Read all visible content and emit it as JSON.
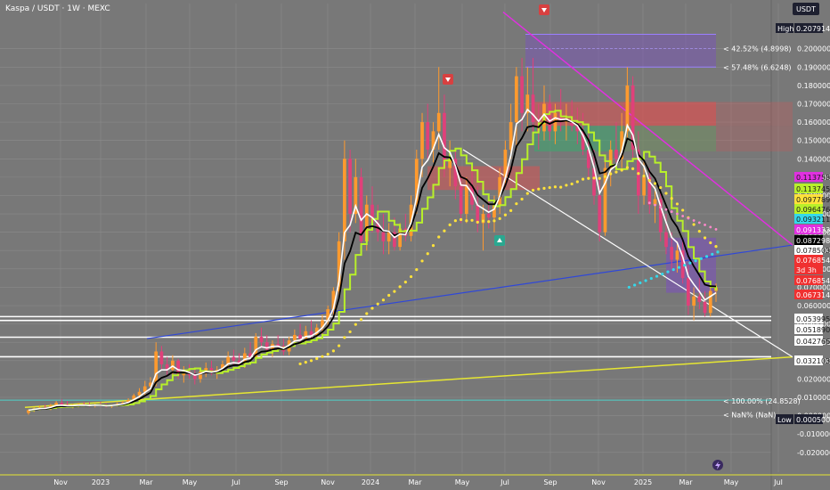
{
  "header": {
    "title": "Kaspa / USDT · 1W · MEXC",
    "currency": "USDT"
  },
  "colors": {
    "background": "#787878",
    "candle_up": "#ff9a2e",
    "candle_down": "#e0407a",
    "ema_fast": "#ffffff",
    "ema_slow": "#000000",
    "step_line": "#b8f02a",
    "dots": "#ffe23a",
    "dots_blue": "#35d8ea",
    "trend_blue": "#3048d8",
    "trend_yellow": "#e6e632",
    "trend_magenta": "#e030e0",
    "trend_white": "#ffffff",
    "supply_zone": "#e05050",
    "demand_zone": "#3aa86e",
    "purple_zone": "#7b4fc0"
  },
  "chart_data": {
    "type": "candlestick",
    "title": "Kaspa / USDT · 1W · MEXC",
    "x_ticks": [
      "Nov",
      "2023",
      "Mar",
      "May",
      "Jul",
      "Sep",
      "Nov",
      "2024",
      "Mar",
      "May",
      "Jul",
      "Sep",
      "Nov",
      "2025",
      "Mar",
      "May",
      "Jul"
    ],
    "y_ticks": [
      0.2,
      0.19,
      0.18,
      0.17,
      0.16,
      0.15,
      0.14,
      0.13,
      0.12,
      0.11,
      0.1,
      0.09,
      0.08,
      0.07,
      0.06,
      0.05,
      0.04,
      0.03,
      0.02,
      0.01,
      0.0,
      -0.01,
      -0.02
    ],
    "ylim": [
      -0.024,
      0.212
    ],
    "price_tags": [
      {
        "label": "High",
        "value": "0.207914",
        "color": "#ffffff",
        "bg": "#1e2030"
      },
      {
        "label": "",
        "value": "0.113758",
        "color": "#1a1a1a",
        "bg": "#e030e0"
      },
      {
        "label": "",
        "value": "0.113745",
        "color": "#1a1a1a",
        "bg": "#b8f02a"
      },
      {
        "label": "",
        "value": "0.097789",
        "color": "#1a1a1a",
        "bg": "#ffe23a"
      },
      {
        "label": "",
        "value": "0.096476",
        "color": "#1a1a1a",
        "bg": "#b8f02a"
      },
      {
        "label": "",
        "value": "0.093211",
        "color": "#1a1a1a",
        "bg": "#35d8ea"
      },
      {
        "label": "",
        "value": "0.091333",
        "color": "#ffffff",
        "bg": "#e030e0"
      },
      {
        "label": "",
        "value": "0.087298",
        "color": "#ffffff",
        "bg": "#000000"
      },
      {
        "label": "",
        "value": "0.078503",
        "color": "#1a1a1a",
        "bg": "#ffffff"
      },
      {
        "label": "",
        "value": "0.076854",
        "color": "#ffffff",
        "bg": "#f03030"
      },
      {
        "label": "",
        "value": "3d 3h",
        "color": "#ffffff",
        "bg": "#f03030"
      },
      {
        "label": "",
        "value": "0.076854",
        "color": "#ffffff",
        "bg": "#f03030"
      },
      {
        "label": "",
        "value": "0.067314",
        "color": "#ffffff",
        "bg": "#f03030"
      },
      {
        "label": "",
        "value": "0.053995",
        "color": "#1a1a1a",
        "bg": "#ffffff"
      },
      {
        "label": "",
        "value": "0.051890",
        "color": "#1a1a1a",
        "bg": "#ffffff"
      },
      {
        "label": "",
        "value": "0.042766",
        "color": "#1a1a1a",
        "bg": "#ffffff"
      },
      {
        "label": "",
        "value": "0.032103",
        "color": "#1a1a1a",
        "bg": "#ffffff"
      },
      {
        "label": "Low",
        "value": "0.000500",
        "color": "#ffffff",
        "bg": "#1e2030"
      }
    ],
    "fib_labels": [
      {
        "text": "42.52% (4.8998)",
        "value": 0.2
      },
      {
        "text": "57.48% (6.6248)",
        "value": 0.19
      },
      {
        "text": "100.00% (24.8528)",
        "value": 0.008
      },
      {
        "text": "NaN% (NaN)",
        "value": 0.0005
      }
    ],
    "horizontal_lines": [
      0.053995,
      0.05189,
      0.042766,
      0.032103
    ],
    "candles": [
      {
        "o": 0.0015,
        "h": 0.0035,
        "l": 0.0005,
        "c": 0.003
      },
      {
        "o": 0.003,
        "h": 0.0045,
        "l": 0.002,
        "c": 0.004
      },
      {
        "o": 0.004,
        "h": 0.0055,
        "l": 0.003,
        "c": 0.0045
      },
      {
        "o": 0.0045,
        "h": 0.006,
        "l": 0.0035,
        "c": 0.004
      },
      {
        "o": 0.004,
        "h": 0.0065,
        "l": 0.003,
        "c": 0.0055
      },
      {
        "o": 0.0055,
        "h": 0.008,
        "l": 0.0045,
        "c": 0.007
      },
      {
        "o": 0.007,
        "h": 0.009,
        "l": 0.005,
        "c": 0.006
      },
      {
        "o": 0.006,
        "h": 0.008,
        "l": 0.0045,
        "c": 0.005
      },
      {
        "o": 0.005,
        "h": 0.0065,
        "l": 0.004,
        "c": 0.0055
      },
      {
        "o": 0.0055,
        "h": 0.007,
        "l": 0.0045,
        "c": 0.006
      },
      {
        "o": 0.006,
        "h": 0.0075,
        "l": 0.005,
        "c": 0.0058
      },
      {
        "o": 0.0058,
        "h": 0.0072,
        "l": 0.0048,
        "c": 0.0052
      },
      {
        "o": 0.0052,
        "h": 0.0068,
        "l": 0.0045,
        "c": 0.006
      },
      {
        "o": 0.006,
        "h": 0.0075,
        "l": 0.005,
        "c": 0.0055
      },
      {
        "o": 0.0055,
        "h": 0.0068,
        "l": 0.0045,
        "c": 0.005
      },
      {
        "o": 0.005,
        "h": 0.0062,
        "l": 0.0042,
        "c": 0.0058
      },
      {
        "o": 0.0058,
        "h": 0.0072,
        "l": 0.005,
        "c": 0.0065
      },
      {
        "o": 0.0065,
        "h": 0.008,
        "l": 0.0055,
        "c": 0.007
      },
      {
        "o": 0.007,
        "h": 0.0095,
        "l": 0.006,
        "c": 0.0085
      },
      {
        "o": 0.0085,
        "h": 0.012,
        "l": 0.0075,
        "c": 0.011
      },
      {
        "o": 0.011,
        "h": 0.015,
        "l": 0.0095,
        "c": 0.013
      },
      {
        "o": 0.013,
        "h": 0.019,
        "l": 0.011,
        "c": 0.016
      },
      {
        "o": 0.016,
        "h": 0.021,
        "l": 0.014,
        "c": 0.018
      },
      {
        "o": 0.018,
        "h": 0.04,
        "l": 0.016,
        "c": 0.035
      },
      {
        "o": 0.035,
        "h": 0.038,
        "l": 0.025,
        "c": 0.028
      },
      {
        "o": 0.028,
        "h": 0.032,
        "l": 0.022,
        "c": 0.025
      },
      {
        "o": 0.025,
        "h": 0.033,
        "l": 0.022,
        "c": 0.03
      },
      {
        "o": 0.03,
        "h": 0.031,
        "l": 0.02,
        "c": 0.022
      },
      {
        "o": 0.022,
        "h": 0.027,
        "l": 0.018,
        "c": 0.024
      },
      {
        "o": 0.024,
        "h": 0.028,
        "l": 0.02,
        "c": 0.022
      },
      {
        "o": 0.022,
        "h": 0.025,
        "l": 0.017,
        "c": 0.02
      },
      {
        "o": 0.02,
        "h": 0.026,
        "l": 0.018,
        "c": 0.024
      },
      {
        "o": 0.024,
        "h": 0.029,
        "l": 0.021,
        "c": 0.026
      },
      {
        "o": 0.026,
        "h": 0.03,
        "l": 0.022,
        "c": 0.023
      },
      {
        "o": 0.023,
        "h": 0.027,
        "l": 0.02,
        "c": 0.025
      },
      {
        "o": 0.025,
        "h": 0.03,
        "l": 0.023,
        "c": 0.028
      },
      {
        "o": 0.028,
        "h": 0.035,
        "l": 0.026,
        "c": 0.032
      },
      {
        "o": 0.032,
        "h": 0.036,
        "l": 0.027,
        "c": 0.03
      },
      {
        "o": 0.03,
        "h": 0.034,
        "l": 0.026,
        "c": 0.028
      },
      {
        "o": 0.028,
        "h": 0.037,
        "l": 0.026,
        "c": 0.034
      },
      {
        "o": 0.034,
        "h": 0.04,
        "l": 0.03,
        "c": 0.032
      },
      {
        "o": 0.032,
        "h": 0.045,
        "l": 0.03,
        "c": 0.043
      },
      {
        "o": 0.043,
        "h": 0.048,
        "l": 0.037,
        "c": 0.04
      },
      {
        "o": 0.04,
        "h": 0.044,
        "l": 0.034,
        "c": 0.036
      },
      {
        "o": 0.036,
        "h": 0.041,
        "l": 0.032,
        "c": 0.039
      },
      {
        "o": 0.039,
        "h": 0.044,
        "l": 0.035,
        "c": 0.038
      },
      {
        "o": 0.038,
        "h": 0.042,
        "l": 0.033,
        "c": 0.035
      },
      {
        "o": 0.035,
        "h": 0.043,
        "l": 0.033,
        "c": 0.041
      },
      {
        "o": 0.041,
        "h": 0.047,
        "l": 0.038,
        "c": 0.044
      },
      {
        "o": 0.044,
        "h": 0.05,
        "l": 0.04,
        "c": 0.042
      },
      {
        "o": 0.042,
        "h": 0.049,
        "l": 0.039,
        "c": 0.046
      },
      {
        "o": 0.046,
        "h": 0.052,
        "l": 0.042,
        "c": 0.044
      },
      {
        "o": 0.044,
        "h": 0.05,
        "l": 0.041,
        "c": 0.048
      },
      {
        "o": 0.048,
        "h": 0.055,
        "l": 0.044,
        "c": 0.052
      },
      {
        "o": 0.052,
        "h": 0.06,
        "l": 0.048,
        "c": 0.058
      },
      {
        "o": 0.058,
        "h": 0.07,
        "l": 0.054,
        "c": 0.068
      },
      {
        "o": 0.068,
        "h": 0.1,
        "l": 0.065,
        "c": 0.095
      },
      {
        "o": 0.095,
        "h": 0.15,
        "l": 0.085,
        "c": 0.14
      },
      {
        "o": 0.14,
        "h": 0.145,
        "l": 0.1,
        "c": 0.11
      },
      {
        "o": 0.11,
        "h": 0.14,
        "l": 0.105,
        "c": 0.13
      },
      {
        "o": 0.13,
        "h": 0.135,
        "l": 0.09,
        "c": 0.095
      },
      {
        "o": 0.095,
        "h": 0.12,
        "l": 0.09,
        "c": 0.115
      },
      {
        "o": 0.115,
        "h": 0.125,
        "l": 0.1,
        "c": 0.105
      },
      {
        "o": 0.105,
        "h": 0.115,
        "l": 0.095,
        "c": 0.1
      },
      {
        "o": 0.1,
        "h": 0.11,
        "l": 0.088,
        "c": 0.095
      },
      {
        "o": 0.095,
        "h": 0.105,
        "l": 0.088,
        "c": 0.1
      },
      {
        "o": 0.1,
        "h": 0.108,
        "l": 0.09,
        "c": 0.092
      },
      {
        "o": 0.092,
        "h": 0.105,
        "l": 0.09,
        "c": 0.102
      },
      {
        "o": 0.102,
        "h": 0.11,
        "l": 0.095,
        "c": 0.098
      },
      {
        "o": 0.098,
        "h": 0.12,
        "l": 0.095,
        "c": 0.115
      },
      {
        "o": 0.115,
        "h": 0.145,
        "l": 0.11,
        "c": 0.14
      },
      {
        "o": 0.14,
        "h": 0.165,
        "l": 0.13,
        "c": 0.16
      },
      {
        "o": 0.16,
        "h": 0.17,
        "l": 0.14,
        "c": 0.145
      },
      {
        "o": 0.145,
        "h": 0.16,
        "l": 0.138,
        "c": 0.155
      },
      {
        "o": 0.155,
        "h": 0.19,
        "l": 0.145,
        "c": 0.165
      },
      {
        "o": 0.165,
        "h": 0.175,
        "l": 0.13,
        "c": 0.135
      },
      {
        "o": 0.135,
        "h": 0.15,
        "l": 0.125,
        "c": 0.14
      },
      {
        "o": 0.14,
        "h": 0.145,
        "l": 0.118,
        "c": 0.125
      },
      {
        "o": 0.125,
        "h": 0.13,
        "l": 0.105,
        "c": 0.11
      },
      {
        "o": 0.11,
        "h": 0.13,
        "l": 0.105,
        "c": 0.125
      },
      {
        "o": 0.125,
        "h": 0.135,
        "l": 0.112,
        "c": 0.115
      },
      {
        "o": 0.115,
        "h": 0.125,
        "l": 0.1,
        "c": 0.105
      },
      {
        "o": 0.105,
        "h": 0.115,
        "l": 0.09,
        "c": 0.11
      },
      {
        "o": 0.11,
        "h": 0.12,
        "l": 0.102,
        "c": 0.108
      },
      {
        "o": 0.108,
        "h": 0.12,
        "l": 0.1,
        "c": 0.115
      },
      {
        "o": 0.115,
        "h": 0.135,
        "l": 0.11,
        "c": 0.13
      },
      {
        "o": 0.13,
        "h": 0.15,
        "l": 0.125,
        "c": 0.145
      },
      {
        "o": 0.145,
        "h": 0.17,
        "l": 0.14,
        "c": 0.16
      },
      {
        "o": 0.16,
        "h": 0.19,
        "l": 0.145,
        "c": 0.185
      },
      {
        "o": 0.185,
        "h": 0.195,
        "l": 0.155,
        "c": 0.165
      },
      {
        "o": 0.165,
        "h": 0.19,
        "l": 0.155,
        "c": 0.175
      },
      {
        "o": 0.175,
        "h": 0.195,
        "l": 0.15,
        "c": 0.16
      },
      {
        "o": 0.16,
        "h": 0.17,
        "l": 0.145,
        "c": 0.155
      },
      {
        "o": 0.155,
        "h": 0.18,
        "l": 0.15,
        "c": 0.17
      },
      {
        "o": 0.17,
        "h": 0.175,
        "l": 0.15,
        "c": 0.155
      },
      {
        "o": 0.155,
        "h": 0.17,
        "l": 0.148,
        "c": 0.165
      },
      {
        "o": 0.165,
        "h": 0.178,
        "l": 0.155,
        "c": 0.16
      },
      {
        "o": 0.16,
        "h": 0.17,
        "l": 0.15,
        "c": 0.162
      },
      {
        "o": 0.162,
        "h": 0.172,
        "l": 0.155,
        "c": 0.158
      },
      {
        "o": 0.158,
        "h": 0.168,
        "l": 0.148,
        "c": 0.155
      },
      {
        "o": 0.155,
        "h": 0.165,
        "l": 0.142,
        "c": 0.145
      },
      {
        "o": 0.145,
        "h": 0.155,
        "l": 0.13,
        "c": 0.135
      },
      {
        "o": 0.135,
        "h": 0.145,
        "l": 0.115,
        "c": 0.12
      },
      {
        "o": 0.12,
        "h": 0.13,
        "l": 0.095,
        "c": 0.1
      },
      {
        "o": 0.1,
        "h": 0.14,
        "l": 0.098,
        "c": 0.135
      },
      {
        "o": 0.135,
        "h": 0.15,
        "l": 0.125,
        "c": 0.145
      },
      {
        "o": 0.145,
        "h": 0.16,
        "l": 0.138,
        "c": 0.14
      },
      {
        "o": 0.14,
        "h": 0.165,
        "l": 0.135,
        "c": 0.155
      },
      {
        "o": 0.155,
        "h": 0.19,
        "l": 0.15,
        "c": 0.18
      },
      {
        "o": 0.18,
        "h": 0.185,
        "l": 0.14,
        "c": 0.145
      },
      {
        "o": 0.145,
        "h": 0.155,
        "l": 0.11,
        "c": 0.12
      },
      {
        "o": 0.12,
        "h": 0.14,
        "l": 0.115,
        "c": 0.13
      },
      {
        "o": 0.13,
        "h": 0.135,
        "l": 0.11,
        "c": 0.115
      },
      {
        "o": 0.115,
        "h": 0.125,
        "l": 0.105,
        "c": 0.118
      },
      {
        "o": 0.118,
        "h": 0.122,
        "l": 0.095,
        "c": 0.1
      },
      {
        "o": 0.1,
        "h": 0.11,
        "l": 0.088,
        "c": 0.092
      },
      {
        "o": 0.092,
        "h": 0.1,
        "l": 0.08,
        "c": 0.085
      },
      {
        "o": 0.085,
        "h": 0.095,
        "l": 0.078,
        "c": 0.09
      },
      {
        "o": 0.09,
        "h": 0.095,
        "l": 0.072,
        "c": 0.075
      },
      {
        "o": 0.075,
        "h": 0.082,
        "l": 0.055,
        "c": 0.06
      },
      {
        "o": 0.06,
        "h": 0.07,
        "l": 0.052,
        "c": 0.065
      },
      {
        "o": 0.065,
        "h": 0.075,
        "l": 0.058,
        "c": 0.062
      },
      {
        "o": 0.062,
        "h": 0.068,
        "l": 0.054,
        "c": 0.056
      },
      {
        "o": 0.056,
        "h": 0.07,
        "l": 0.054,
        "c": 0.068
      },
      {
        "o": 0.068,
        "h": 0.072,
        "l": 0.062,
        "c": 0.07
      }
    ]
  }
}
